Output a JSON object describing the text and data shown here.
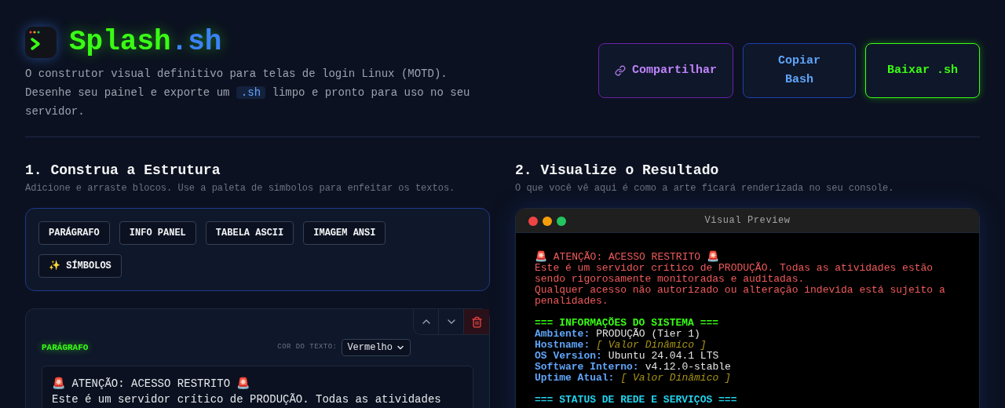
{
  "header": {
    "title_main": "Splash",
    "title_ext": ".sh",
    "tagline": "O construtor visual definitivo para telas de login Linux (MOTD).",
    "desc_before": "Desenhe seu painel e exporte um",
    "desc_code": ".sh",
    "desc_after": "limpo e pronto para uso no seu servidor."
  },
  "actions": [
    {
      "label": "Compartilhar",
      "kind": "share"
    },
    {
      "label": "Copiar Bash",
      "kind": "copy"
    },
    {
      "label": "Baixar .sh",
      "kind": "download"
    }
  ],
  "builder": {
    "title": "1. Construa a Estrutura",
    "subtitle": "Adicione e arraste blocos. Use a paleta de símbolos para enfeitar os textos.",
    "palette": [
      "PARÁGRAFO",
      "INFO PANEL",
      "TABELA ASCII",
      "IMAGEM ANSI",
      "✨ SÍMBOLOS"
    ],
    "block": {
      "type": "PARÁGRAFO",
      "color_label": "COR DO TEXTO:",
      "color_value": "Vermelho",
      "lines": [
        "🚨 ATENÇÃO: ACESSO RESTRITO 🚨",
        "Este é um servidor crítico de PRODUÇÃO. Todas as atividades"
      ]
    }
  },
  "preview": {
    "title": "2. Visualize o Resultado",
    "subtitle": "O que você vê aqui é como a arte ficará renderizada no seu console.",
    "window_title": "Visual Preview",
    "lines": [
      {
        "kind": "text",
        "color": "#f05a5a",
        "text": "🚨 ATENÇÃO: ACESSO RESTRITO 🚨"
      },
      {
        "kind": "text",
        "color": "#f05a5a",
        "text": "Este é um servidor crítico de PRODUÇÃO. Todas as atividades estão"
      },
      {
        "kind": "text",
        "color": "#f05a5a",
        "text": "sendo rigorosamente monitoradas e auditadas."
      },
      {
        "kind": "text",
        "color": "#f05a5a",
        "text": "Qualquer acesso não autorizado ou alteração indevida está sujeito a"
      },
      {
        "kind": "text",
        "color": "#f05a5a",
        "text": "penalidades."
      },
      {
        "kind": "blank"
      },
      {
        "kind": "heading",
        "color": "#39ff14",
        "text": "=== INFORMAÇÕES DO SISTEMA ==="
      },
      {
        "kind": "kv",
        "key": "Ambiente:",
        "value": "PRODUÇÃO (Tier 1)",
        "dynamic": false
      },
      {
        "kind": "kv",
        "key": "Hostname:",
        "value": "[ Valor Dinâmico ]",
        "dynamic": true
      },
      {
        "kind": "kv",
        "key": "OS Version:",
        "value": "Ubuntu 24.04.1 LTS",
        "dynamic": false
      },
      {
        "kind": "kv",
        "key": "Software Interno:",
        "value": "v4.12.0-stable",
        "dynamic": false
      },
      {
        "kind": "kv",
        "key": "Uptime Atual:",
        "value": "[ Valor Dinâmico ]",
        "dynamic": true
      },
      {
        "kind": "blank"
      },
      {
        "kind": "heading",
        "color": "#22d3ee",
        "text": "=== STATUS DE REDE E SERVIÇOS ==="
      }
    ]
  }
}
